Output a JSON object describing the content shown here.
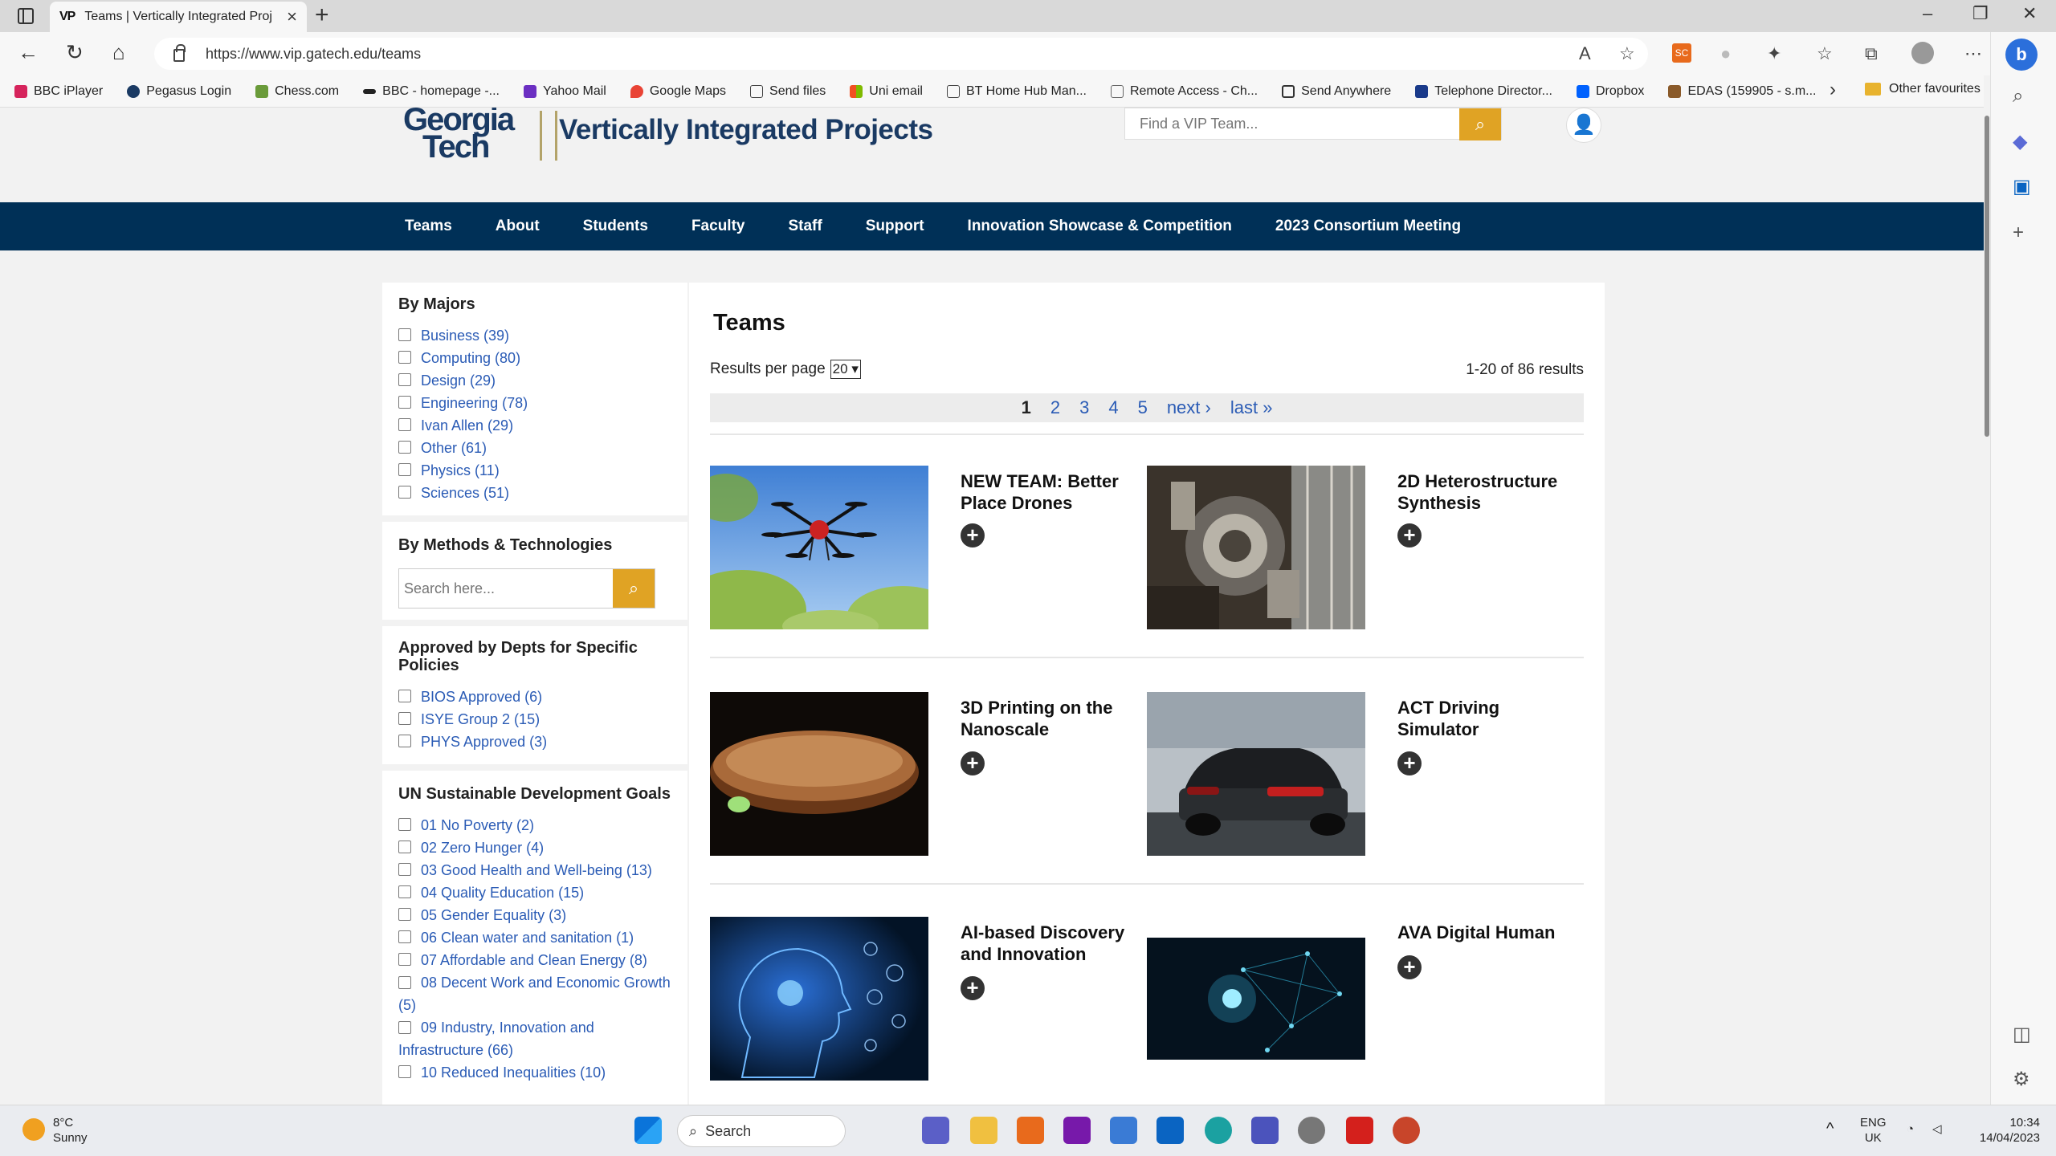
{
  "browser": {
    "tab_title": "Teams | Vertically Integrated Proj",
    "tab_favicon": "VP",
    "url": "https://www.vip.gatech.edu/teams",
    "bookmarks": [
      "BBC iPlayer",
      "Pegasus Login",
      "Chess.com",
      "BBC - homepage -...",
      "Yahoo Mail",
      "Google Maps",
      "Send files",
      "Uni email",
      "BT Home Hub Man...",
      "Remote Access - Ch...",
      "Send Anywhere",
      "Telephone Director...",
      "Dropbox",
      "EDAS (159905 - s.m..."
    ],
    "other_favourites": "Other favourites"
  },
  "header": {
    "logo_line1": "Georgia",
    "logo_line2": "Tech",
    "logo_title": "Vertically Integrated Projects",
    "search_placeholder": "Find a VIP Team..."
  },
  "nav": [
    "Teams",
    "About",
    "Students",
    "Faculty",
    "Staff",
    "Support",
    "Innovation Showcase & Competition",
    "2023 Consortium Meeting"
  ],
  "facets": {
    "majors_title": "By Majors",
    "majors": [
      "Business (39)",
      "Computing (80)",
      "Design (29)",
      "Engineering (78)",
      "Ivan Allen (29)",
      "Other (61)",
      "Physics (11)",
      "Sciences (51)"
    ],
    "methods_title": "By Methods & Technologies",
    "methods_placeholder": "Search here...",
    "approved_title": "Approved by Depts for Specific Policies",
    "approved": [
      "BIOS Approved (6)",
      "ISYE Group 2 (15)",
      "PHYS Approved (3)"
    ],
    "sdg_title": "UN Sustainable Development Goals",
    "sdg": [
      "01 No Poverty (2)",
      "02 Zero Hunger (4)",
      "03 Good Health and Well-being (13)",
      "04 Quality Education (15)",
      "05 Gender Equality (3)",
      "06 Clean water and sanitation (1)",
      "07 Affordable and Clean Energy (8)",
      "08 Decent Work and Economic Growth (5)",
      "09 Industry, Innovation and Infrastructure (66)",
      "10 Reduced Inequalities (10)"
    ]
  },
  "content": {
    "title": "Teams",
    "rpp_label": "Results per page",
    "rpp_value": "20",
    "result_count": "1-20 of 86 results",
    "pager": {
      "current": "1",
      "pages": [
        "2",
        "3",
        "4",
        "5"
      ],
      "next": "next ›",
      "last": "last »"
    },
    "teams": [
      {
        "title": "NEW TEAM: Better Place Drones"
      },
      {
        "title": "2D Heterostructure Synthesis"
      },
      {
        "title": "3D Printing on the Nanoscale"
      },
      {
        "title": "ACT Driving Simulator"
      },
      {
        "title": "AI-based Discovery and Innovation"
      },
      {
        "title": "AVA Digital Human"
      }
    ]
  },
  "taskbar": {
    "temp": "8°C",
    "condition": "Sunny",
    "search": "Search",
    "lang1": "ENG",
    "lang2": "UK",
    "time": "10:34",
    "date": "14/04/2023"
  }
}
